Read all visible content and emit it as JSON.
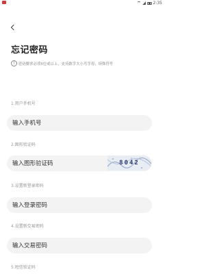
{
  "status_bar": {
    "time": "2:35"
  },
  "header": {
    "title": "忘记密码"
  },
  "notice": {
    "text": "密码要求必须8位或以上，支持数字大小写字母，特殊符号"
  },
  "fields": {
    "phone": {
      "label": "1.用户手机号",
      "placeholder": "输入手机号"
    },
    "captcha": {
      "label": "2.图形验证码",
      "placeholder": "输入图形验证码",
      "code": "8042"
    },
    "login_password": {
      "label": "3.设置新登录密码",
      "placeholder": "输入登录密码"
    },
    "trade_password": {
      "label": "4.设置新交易密码",
      "placeholder": "输入交易密码"
    },
    "sms_code": {
      "label": "5.短信验证码"
    }
  }
}
